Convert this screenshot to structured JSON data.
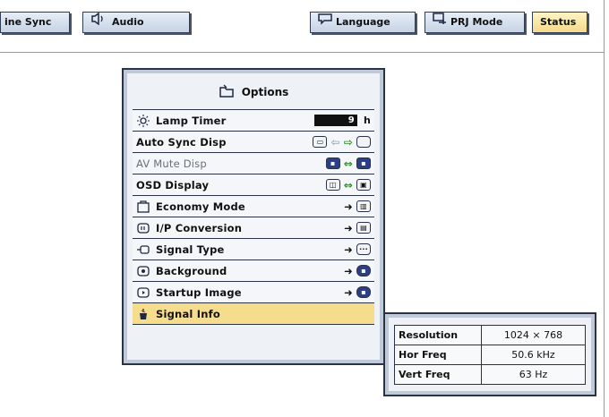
{
  "tabs": [
    {
      "label": "ine Sync"
    },
    {
      "label": "Audio"
    },
    {
      "label": "Language"
    },
    {
      "label": "PRJ Mode"
    },
    {
      "label": "Status"
    }
  ],
  "options_panel": {
    "title": "Options",
    "rows": [
      {
        "label": "Lamp Timer",
        "value": "9",
        "unit": "h"
      },
      {
        "label": "Auto Sync Disp"
      },
      {
        "label": "AV Mute Disp"
      },
      {
        "label": "OSD Display"
      },
      {
        "label": "Economy Mode"
      },
      {
        "label": "I/P Conversion"
      },
      {
        "label": "Signal Type"
      },
      {
        "label": "Background"
      },
      {
        "label": "Startup Image"
      },
      {
        "label": "Signal Info"
      }
    ]
  },
  "status_box": {
    "rows": [
      {
        "key": "Resolution",
        "value": "1024 × 768"
      },
      {
        "key": "Hor Freq",
        "value": "50.6 kHz"
      },
      {
        "key": "Vert Freq",
        "value": "63  Hz"
      }
    ]
  },
  "colors": {
    "selected_row": "#f6dd8e",
    "active_tab": "#f3d98a",
    "panel_border": "#2a3346"
  }
}
